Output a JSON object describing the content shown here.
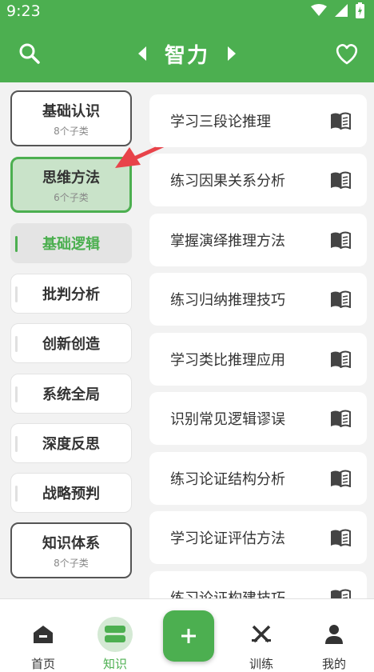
{
  "status": {
    "time": "9:23"
  },
  "header": {
    "title": "智力"
  },
  "categories": [
    {
      "name": "基础认识",
      "sub": "8个子类"
    },
    {
      "name": "思维方法",
      "sub": "6个子类"
    },
    {
      "name": "基础逻辑"
    },
    {
      "name": "批判分析"
    },
    {
      "name": "创新创造"
    },
    {
      "name": "系统全局"
    },
    {
      "name": "深度反思"
    },
    {
      "name": "战略预判"
    },
    {
      "name": "知识体系",
      "sub": "8个子类"
    }
  ],
  "items": [
    "学习三段论推理",
    "练习因果关系分析",
    "掌握演绎推理方法",
    "练习归纳推理技巧",
    "学习类比推理应用",
    "识别常见逻辑谬误",
    "练习论证结构分析",
    "学习论证评估方法",
    "练习论证构建技巧"
  ],
  "nav": {
    "home": "首页",
    "knowledge": "知识",
    "training": "训练",
    "mine": "我的"
  },
  "colors": {
    "accent": "#4caf50",
    "annotation_arrow": "#e8434a"
  }
}
